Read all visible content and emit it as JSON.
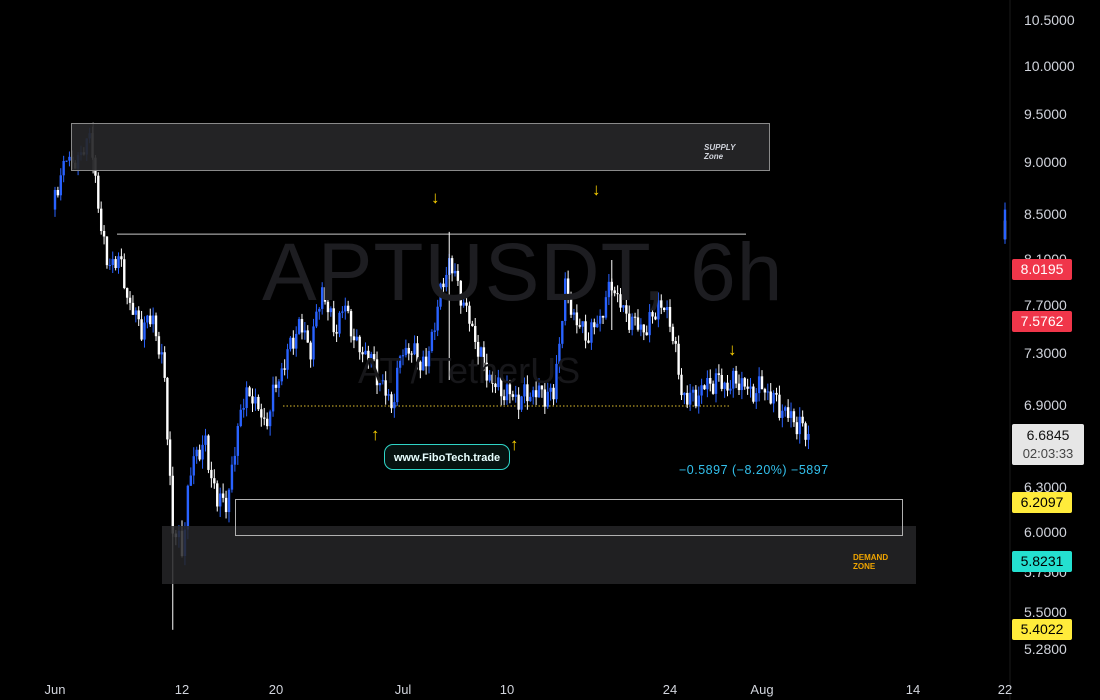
{
  "chart_data": {
    "type": "candlestick",
    "watermark": {
      "symbol": "APTUSDT, 6h",
      "subtitle": "AT / TetherUS"
    },
    "y_axis": {
      "ticks": [
        "10.5000",
        "10.0000",
        "9.5000",
        "9.0000",
        "8.5000",
        "8.1000",
        "7.7000",
        "7.3000",
        "6.9000",
        "6.3000",
        "6.0000",
        "5.7500",
        "5.5000",
        "5.2800"
      ]
    },
    "x_axis": {
      "ticks": [
        "Jun",
        "12",
        "20",
        "Jul",
        "10",
        "24",
        "Aug",
        "14",
        "22"
      ]
    },
    "price_tags": [
      {
        "value": "8.0195",
        "bg": "#f0364a",
        "fg": "#ffffff"
      },
      {
        "value": "7.5762",
        "bg": "#f0364a",
        "fg": "#ffffff"
      },
      {
        "value": "6.2097",
        "bg": "#ffeb3b",
        "fg": "#000000"
      },
      {
        "value": "5.8231",
        "bg": "#24e0d0",
        "fg": "#000000"
      },
      {
        "value": "5.4022",
        "bg": "#ffeb3b",
        "fg": "#000000"
      }
    ],
    "current_price": {
      "value": "6.6845",
      "countdown": "02:03:33"
    },
    "zones": [
      {
        "label": "SUPPLY Zone",
        "top": 9.42,
        "bottom": 8.92,
        "label_color": "#d1d4dc"
      },
      {
        "label": "DEMAND ZONE",
        "top": 6.05,
        "bottom": 5.68,
        "label_color": "#f0a500"
      },
      {
        "label": "",
        "top": 6.23,
        "bottom": 5.98,
        "label_color": ""
      }
    ],
    "levels": [
      {
        "value": 8.33,
        "color": "#c8c8c8",
        "style": "solid"
      },
      {
        "value": 6.9,
        "color": "#e0c030",
        "style": "dotted"
      }
    ],
    "measurement": "−0.5897 (−8.20%) −5897",
    "site_badge": "www.FiboTech.trade",
    "colors": {
      "up": "#2962ff",
      "down": "#ffffff"
    }
  }
}
